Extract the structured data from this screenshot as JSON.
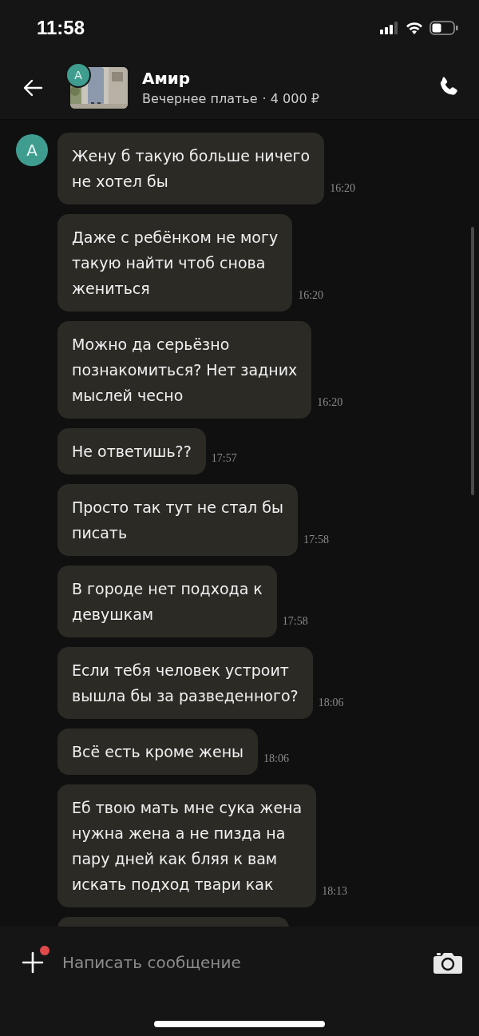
{
  "status_bar": {
    "time": "11:58"
  },
  "header": {
    "contact_initial": "А",
    "name": "Амир",
    "item": "Вечернее платье",
    "price": "· 4 000 ₽"
  },
  "messages": [
    {
      "kind": "text",
      "avatar": "А",
      "text": "Жену б такую больше ничего\nне хотел бы",
      "time": "16:20"
    },
    {
      "kind": "text",
      "text": "Даже с ребёнком не могу\nтакую найти чтоб снова\nжениться",
      "time": "16:20"
    },
    {
      "kind": "text",
      "text": "Можно да серьёзно\nпознакомиться? Нет задних\nмыслей чесно",
      "time": "16:20"
    },
    {
      "kind": "text",
      "text": "Не ответишь??",
      "time": "17:57"
    },
    {
      "kind": "text",
      "text": "Просто так тут не стал бы\nписать",
      "time": "17:58"
    },
    {
      "kind": "text",
      "text": "В городе нет подхода к\nдевушкам",
      "time": "17:58"
    },
    {
      "kind": "text",
      "text": "Если тебя человек устроит\nвышла бы за разведенного?",
      "time": "18:06"
    },
    {
      "kind": "text",
      "text": "Всё есть кроме жены",
      "time": "18:06"
    },
    {
      "kind": "text",
      "text": "Еб твою мать мне сука жена\nнужна жена а не пизда на\nпару дней как бляя к вам\nискать подход твари как",
      "time": "18:13"
    },
    {
      "kind": "partial"
    }
  ],
  "composer": {
    "placeholder": "Написать сообщение",
    "attach_badge": true
  }
}
